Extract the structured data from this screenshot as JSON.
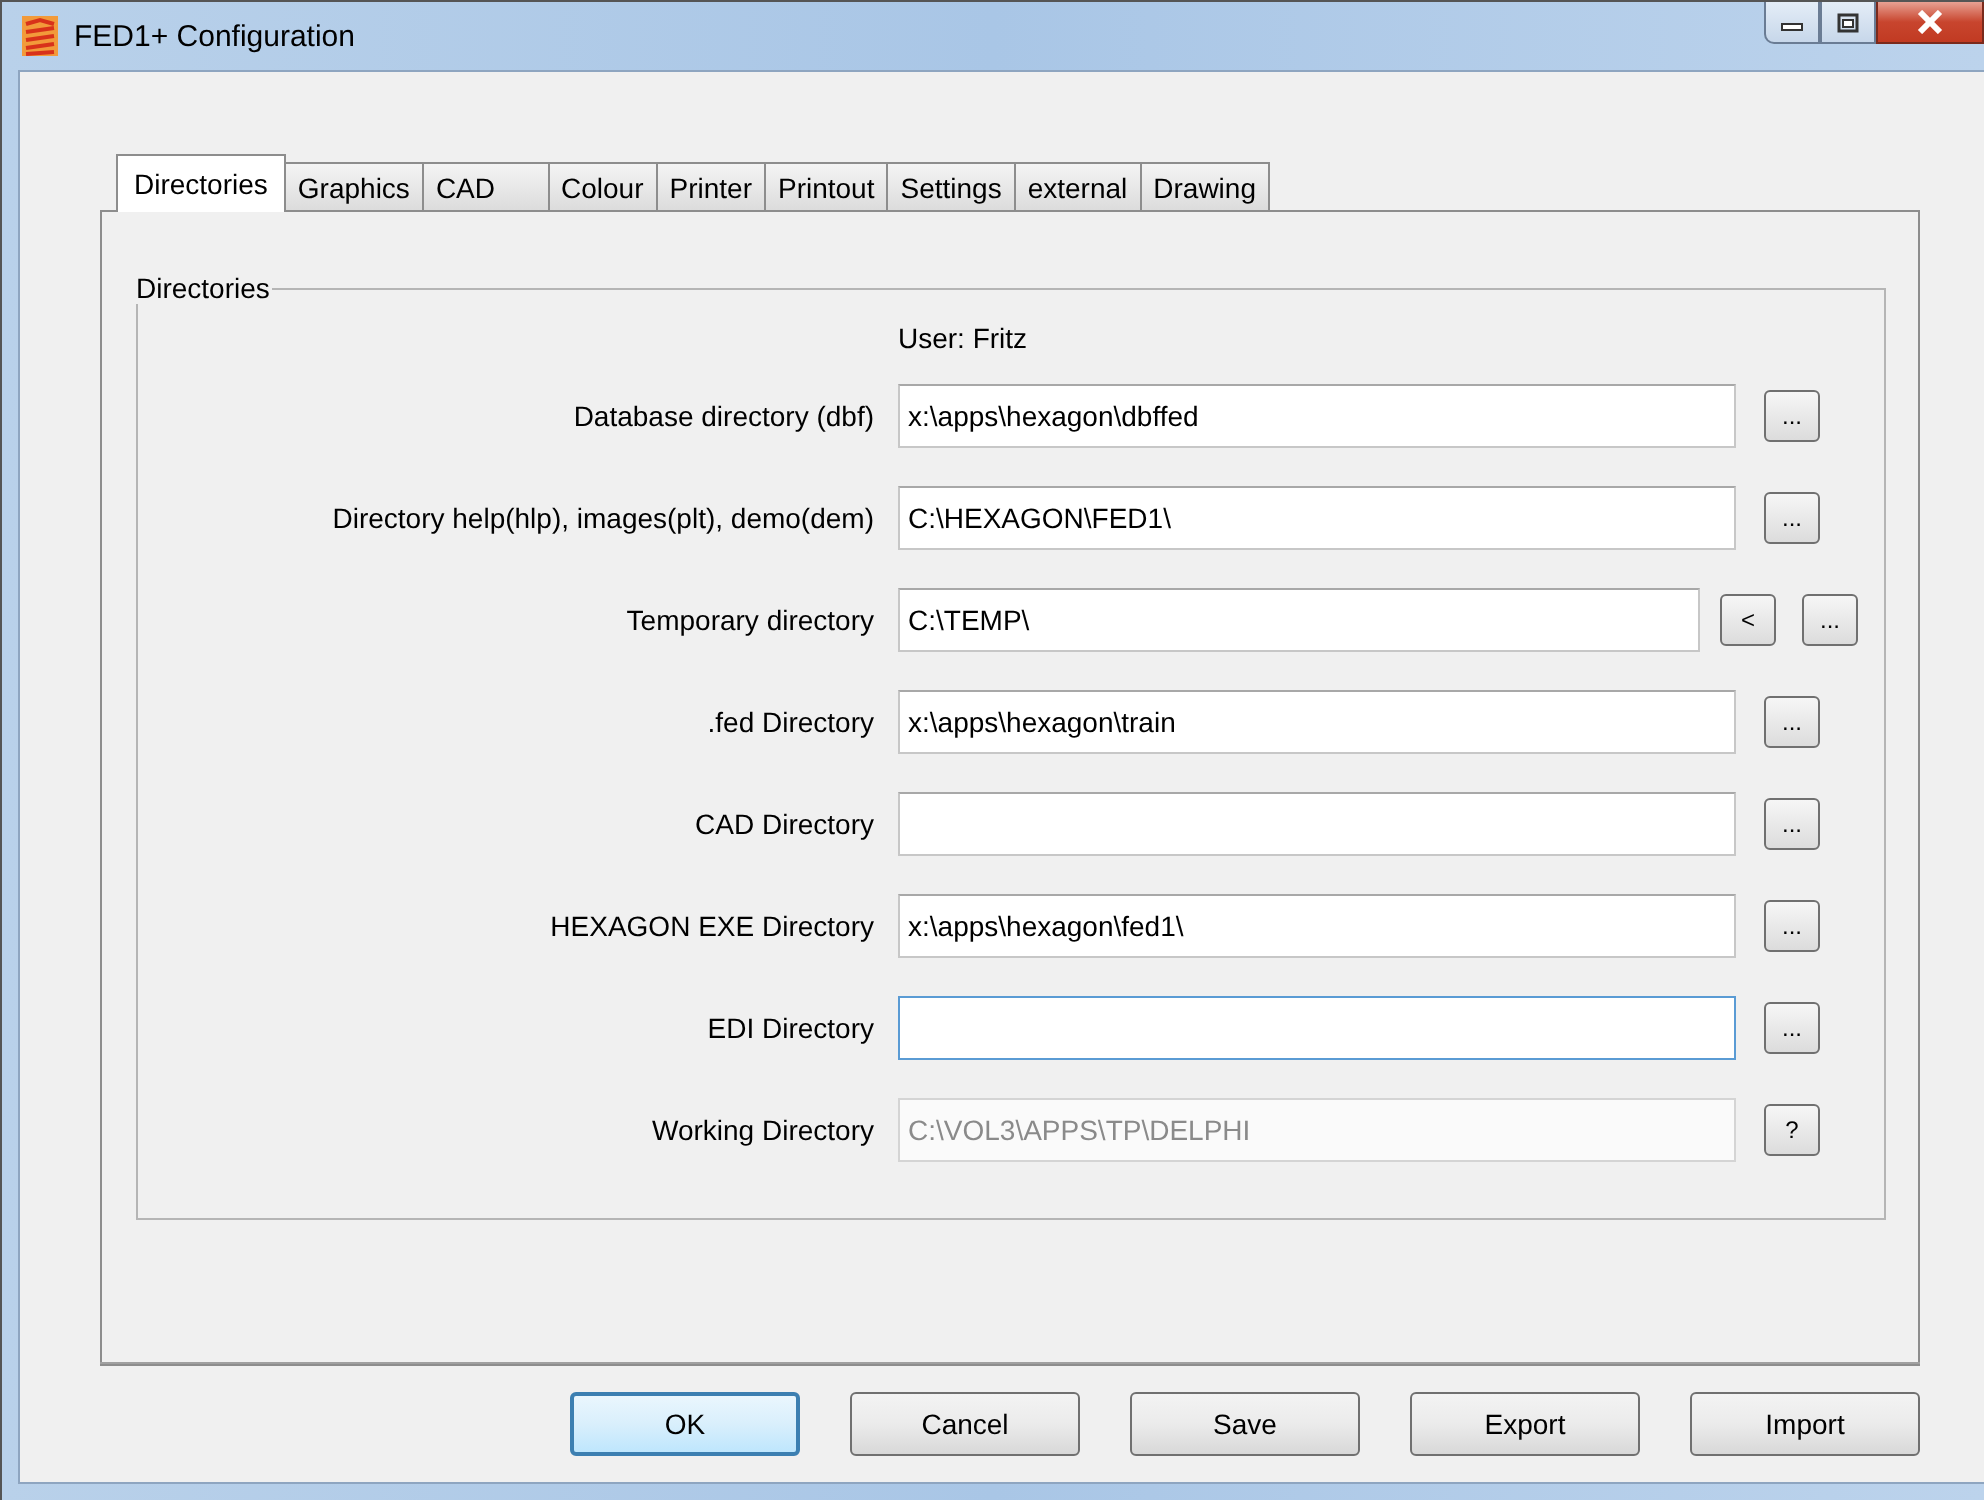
{
  "window": {
    "title": "FED1+ Configuration"
  },
  "tabs": [
    {
      "label": "Directories",
      "selected": true
    },
    {
      "label": "Graphics",
      "selected": false
    },
    {
      "label": "CAD",
      "selected": false
    },
    {
      "label": "Colour",
      "selected": false
    },
    {
      "label": "Printer",
      "selected": false
    },
    {
      "label": "Printout",
      "selected": false
    },
    {
      "label": "Settings",
      "selected": false
    },
    {
      "label": "external",
      "selected": false
    },
    {
      "label": "Drawing",
      "selected": false
    }
  ],
  "group": {
    "title": "Directories",
    "user": "User: Fritz",
    "rows": [
      {
        "label": "Database directory (dbf)",
        "value": "x:\\apps\\hexagon\\dbffed",
        "disabled": false,
        "focused": false,
        "buttons": [
          "..."
        ]
      },
      {
        "label": "Directory help(hlp), images(plt), demo(dem)",
        "value": "C:\\HEXAGON\\FED1\\",
        "disabled": false,
        "focused": false,
        "buttons": [
          "..."
        ]
      },
      {
        "label": "Temporary directory",
        "value": "C:\\TEMP\\",
        "disabled": false,
        "focused": false,
        "buttons": [
          "<",
          "..."
        ]
      },
      {
        "label": ".fed Directory",
        "value": "x:\\apps\\hexagon\\train",
        "disabled": false,
        "focused": false,
        "buttons": [
          "..."
        ]
      },
      {
        "label": "CAD Directory",
        "disabled": false,
        "focused": false,
        "buttons": [
          "..."
        ]
      },
      {
        "label": "HEXAGON EXE Directory",
        "value": "x:\\apps\\hexagon\\fed1\\",
        "disabled": false,
        "focused": false,
        "buttons": [
          "..."
        ]
      },
      {
        "label": "EDI Directory",
        "disabled": false,
        "focused": true,
        "buttons": [
          "..."
        ]
      },
      {
        "label": "Working Directory",
        "value": "C:\\VOL3\\APPS\\TP\\DELPHI",
        "disabled": true,
        "focused": false,
        "buttons": [
          "?"
        ]
      }
    ]
  },
  "buttons": [
    {
      "label": "OK",
      "default": true
    },
    {
      "label": "Cancel",
      "default": false
    },
    {
      "label": "Save",
      "default": false
    },
    {
      "label": "Export",
      "default": false
    },
    {
      "label": "Import",
      "default": false
    }
  ]
}
